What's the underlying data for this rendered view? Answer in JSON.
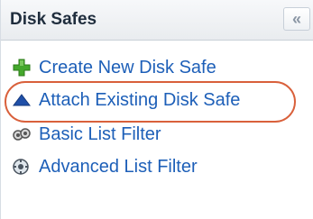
{
  "panel": {
    "title": "Disk Safes",
    "collapse_glyph": "«"
  },
  "menu": {
    "items": [
      {
        "label": "Create New Disk Safe",
        "icon": "green-plus-icon"
      },
      {
        "label": "Attach Existing Disk Safe",
        "icon": "blue-triangle-icon",
        "highlighted": true
      },
      {
        "label": "Basic List Filter",
        "icon": "filter-icon"
      },
      {
        "label": "Advanced List Filter",
        "icon": "advanced-filter-icon"
      }
    ]
  },
  "colors": {
    "link": "#1d5fb8",
    "highlight_outline": "#d9603b",
    "header_text": "#1f2d3d"
  }
}
